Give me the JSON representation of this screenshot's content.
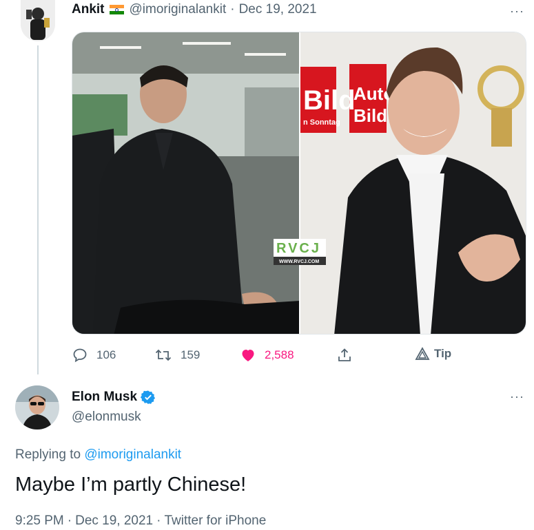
{
  "parent_tweet": {
    "author_name": "Ankit",
    "author_handle": "@imoriginalankit",
    "separator": "·",
    "date": "Dec 19, 2021",
    "more_label": "···",
    "flag_colors": [
      "#ff9933",
      "#ffffff",
      "#138808"
    ],
    "media": {
      "watermark_text": "RVCJ",
      "watermark_url": "WWW.RVCJ.COM",
      "sign_text_1": "Bild",
      "sign_text_2": "n Sonntag",
      "sign_text_3": "Auto",
      "sign_text_4": "Bild"
    },
    "actions": {
      "reply_count": "106",
      "retweet_count": "159",
      "like_count": "2,588",
      "tip_label": "Tip"
    }
  },
  "reply_tweet": {
    "author_name": "Elon Musk",
    "author_handle": "@elonmusk",
    "more_label": "···",
    "replying_prefix": "Replying to",
    "replying_handle": "@imoriginalankit",
    "text": "Maybe I’m partly Chinese!",
    "time": "9:25 PM",
    "separator": "·",
    "date": "Dec 19, 2021",
    "source": "Twitter for iPhone"
  },
  "colors": {
    "like": "#f91880",
    "link": "#1d9bf0",
    "muted": "#536471",
    "verified": "#1d9bf0"
  }
}
